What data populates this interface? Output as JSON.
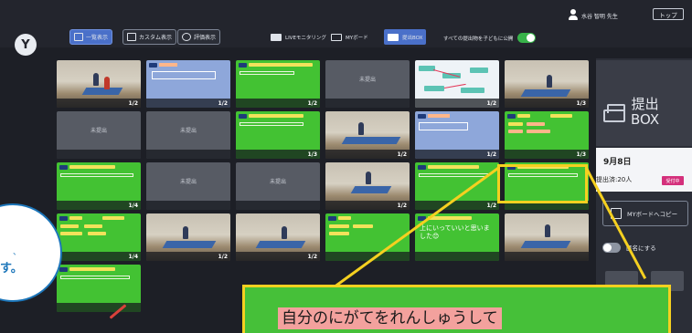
{
  "app": {
    "logo_glyph": "Y",
    "user_name": "水谷 智明 先生",
    "top_button": "トップ"
  },
  "view_buttons": [
    {
      "label": "一覧表示",
      "icon": "grid-icon"
    },
    {
      "label": "カスタム表示",
      "icon": "grid-icon"
    },
    {
      "label": "評価表示",
      "icon": "circle-icon"
    }
  ],
  "nav_tabs": [
    {
      "label": "LIVEモニタリング",
      "icon": "monitor-icon"
    },
    {
      "label": "MYボード",
      "icon": "board-icon"
    },
    {
      "label": "提出BOX",
      "icon": "tray-icon",
      "active": true
    }
  ],
  "share": {
    "label": "すべての提出物を子どもに公開",
    "toggle": "on"
  },
  "tiles": {
    "placeholder": "未提出",
    "page_labels": [
      "1/2",
      "1/2",
      "1/2",
      "1/2",
      "1/3",
      "1/3",
      "1/2",
      "1/2",
      "1/3",
      "1/4",
      "1/2",
      "1/2",
      "1/4",
      "1/2",
      "1/2"
    ],
    "speech_text": "上にいっていいと思いました😊"
  },
  "side_panel": {
    "title_line1": "提出",
    "title_line2": "BOX",
    "date": "9月8日",
    "count": "提出済:20人",
    "receiving": "受付中",
    "copy_button": "MYボードへコピー",
    "anon_label": "匿名にする"
  },
  "callout": {
    "text": "す。",
    "mark": "、"
  },
  "zoom": {
    "text": "自分のにがてをれんしゅうして"
  },
  "colors": {
    "background": "#1d1f26",
    "tile_green": "#43c233",
    "tile_gray": "#575b64",
    "tile_blue": "#8ea7da",
    "highlight": "#f5d020",
    "accent_blue": "#4a70c9",
    "receiving": "#d4307c"
  }
}
